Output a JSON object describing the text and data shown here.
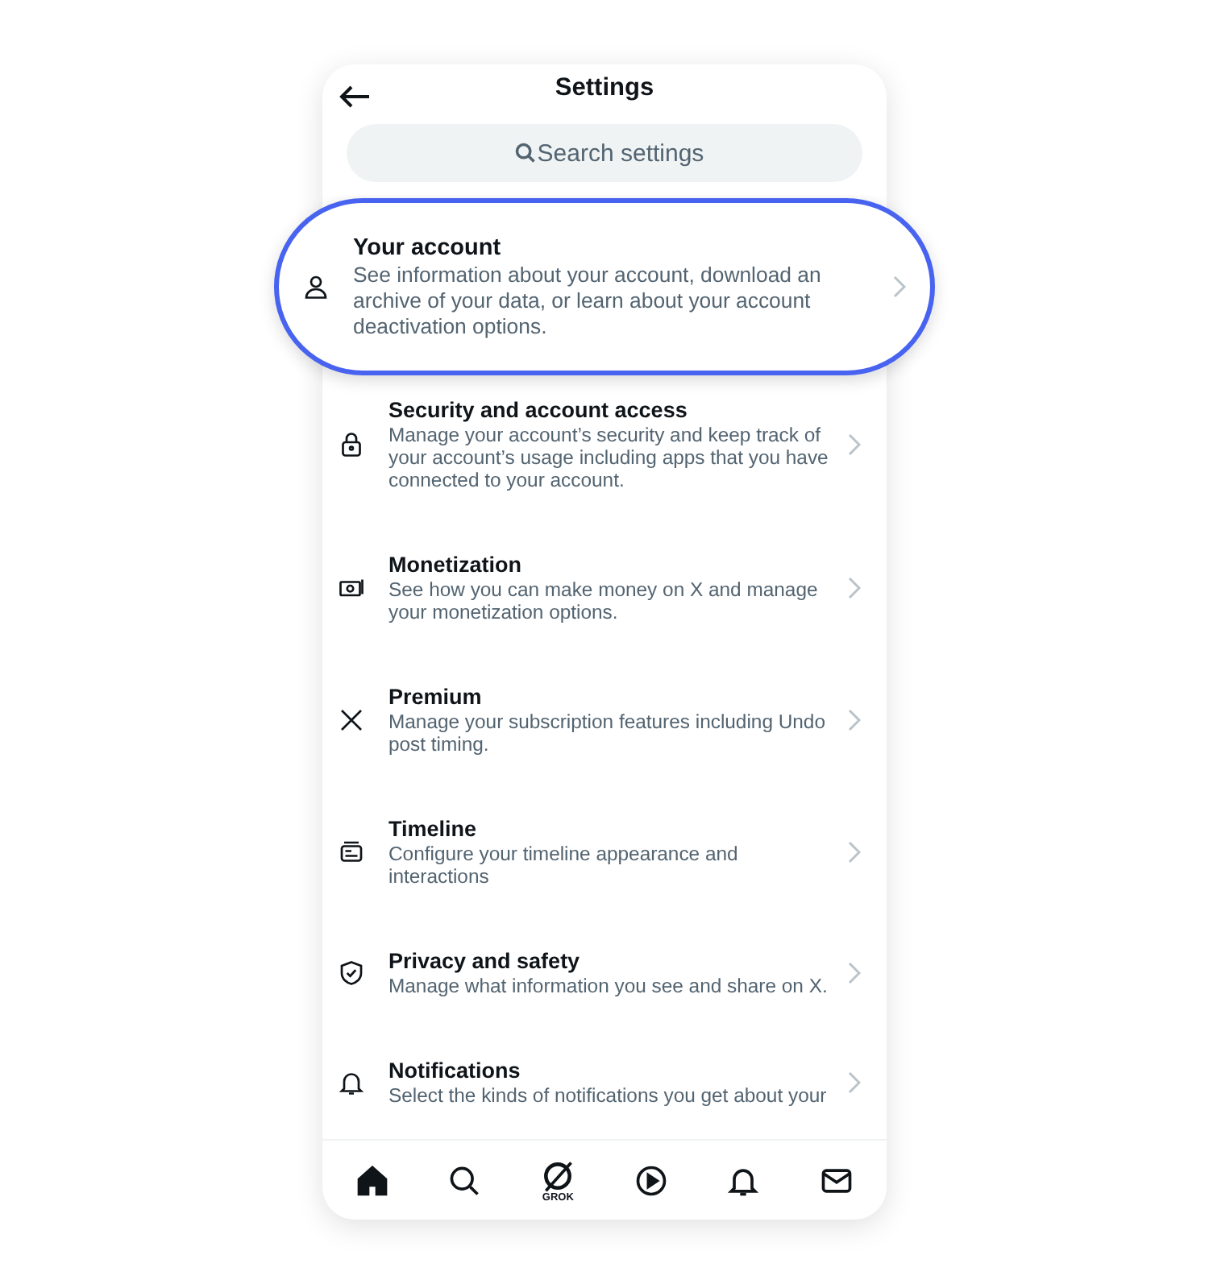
{
  "header": {
    "title": "Settings"
  },
  "search": {
    "placeholder": "Search settings"
  },
  "items": [
    {
      "title": "Your account",
      "description": "See information about your account, download an archive of your data, or learn about your account deactivation options.",
      "highlighted": true
    },
    {
      "title": "Security and account access",
      "description": "Manage your account’s security and keep track of your account’s usage including apps that you have connected to your account.",
      "highlighted": false
    },
    {
      "title": "Monetization",
      "description": "See how you can make money on X and manage your monetization options.",
      "highlighted": false
    },
    {
      "title": "Premium",
      "description": "Manage your subscription features including Undo post timing.",
      "highlighted": false
    },
    {
      "title": "Timeline",
      "description": "Configure your timeline appearance and interactions",
      "highlighted": false
    },
    {
      "title": "Privacy and safety",
      "description": "Manage what information you see and share on X.",
      "highlighted": false
    },
    {
      "title": "Notifications",
      "description": "Select the kinds of notifications you get about your",
      "highlighted": false
    }
  ],
  "bottom_nav": [
    {
      "selected": true
    },
    {
      "selected": false
    },
    {
      "label": "GROK",
      "selected": false
    },
    {
      "selected": false
    },
    {
      "selected": false
    },
    {
      "selected": false
    }
  ]
}
